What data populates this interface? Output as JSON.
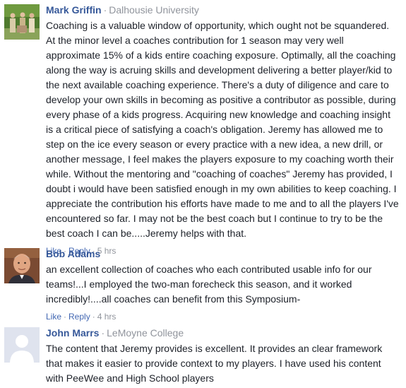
{
  "comments": [
    {
      "author": "Mark Griffin",
      "affiliation": "Dalhousie University",
      "text": "Coaching is a valuable window of opportunity, which ought not be squandered. At the minor level a coaches contribution for 1 season may very well approximate 15% of a kids entire coaching exposure. Optimally, all the coaching along the way is acruing skills and development delivering a better player/kid to the next available coaching experience. There's a duty of diligence and care to develop your own skills in becoming as positive a contributor as possible, during every phase of a kids progress. Acquiring new knowledge and coaching insight is a critical piece of satisfying a coach's obligation. Jeremy has allowed me to step on the ice every season or every practice with a new idea, a new drill, or another message, I feel makes the players exposure to my coaching worth their while. Without the mentoring and \"coaching of coaches\" Jeremy has provided, I doubt i would have been satisfied enough in my own abilities to keep coaching. I appreciate the contribution his efforts have made to me and to all the players I've encountered so far. I may not be the best coach but I continue to try to be the best coach I can be.....Jeremy helps with that.",
      "like": "Like",
      "reply": "Reply",
      "time": "5 hrs"
    },
    {
      "author": "Bob Adams",
      "affiliation": "",
      "text": "an excellent collection of coaches who each contributed usable info for our teams!...I employed the two-man forecheck this season, and it worked incredibly!....all coaches can benefit from this Symposium-",
      "like": "Like",
      "reply": "Reply",
      "time": "4 hrs"
    },
    {
      "author": "John Marrs",
      "affiliation": "LeMoyne College",
      "text": "The content that Jeremy provides is excellent. It provides an clear framework that makes it easier to provide context to my players. I have used his content with PeeWee and High School players"
    }
  ],
  "separators": {
    "middot": "·"
  },
  "colors": {
    "author_link": "#365899",
    "action_link": "#4267b2",
    "muted": "#90949c",
    "text": "#1d2129"
  },
  "icons": {
    "avatar_1": "group-photo-avatar",
    "avatar_2": "person-photo-avatar",
    "avatar_3": "default-silhouette-avatar"
  }
}
